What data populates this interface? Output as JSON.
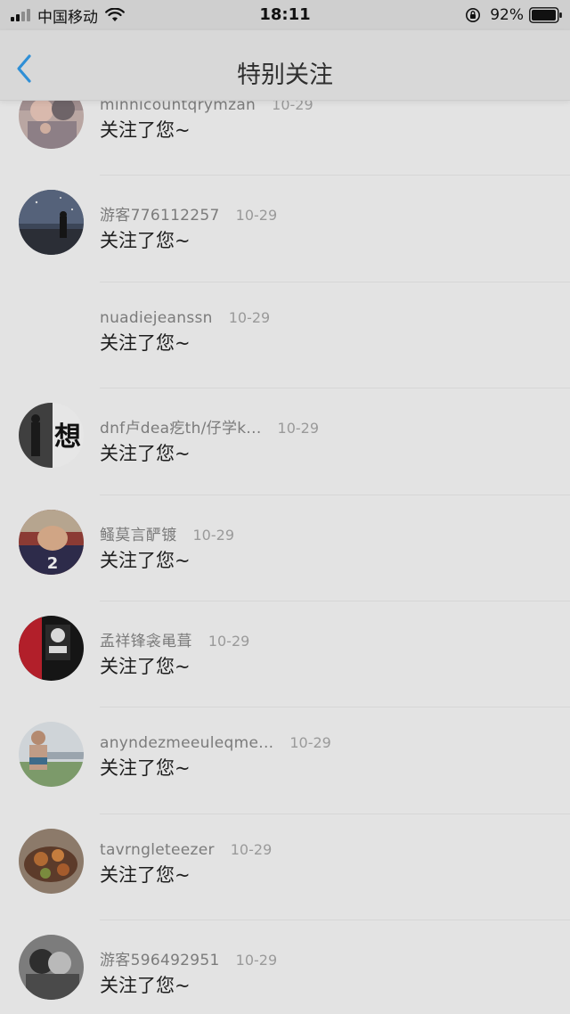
{
  "status_bar": {
    "carrier": "中国移动",
    "time": "18:11",
    "battery_percent": "92%"
  },
  "nav": {
    "title": "特别关注",
    "back_icon": "chevron-left-icon"
  },
  "colors": {
    "accent": "#2f8fd6",
    "overlay_bg": "#e3e3e3"
  },
  "notifications": [
    {
      "username": "minnicountqrymzan",
      "date": "10-29",
      "message": "关注了您~",
      "avatar": "couple-photo"
    },
    {
      "username": "游客776112257",
      "date": "10-29",
      "message": "关注了您~",
      "avatar": "night-sky"
    },
    {
      "username": "nuadiejeanssn",
      "date": "10-29",
      "message": "关注了您~",
      "avatar": "none"
    },
    {
      "username": "dnf卢dea疙th/仔学k...",
      "date": "10-29",
      "message": "关注了您~",
      "avatar": "xiang-text"
    },
    {
      "username": "鳋莫言酽镀",
      "date": "10-29",
      "message": "关注了您~",
      "avatar": "fist"
    },
    {
      "username": "孟祥锋衾黾葺",
      "date": "10-29",
      "message": "关注了您~",
      "avatar": "dark-red"
    },
    {
      "username": "anyndezmeeuleqme...",
      "date": "10-29",
      "message": "关注了您~",
      "avatar": "athlete"
    },
    {
      "username": "tavrngleteezer",
      "date": "10-29",
      "message": "关注了您~",
      "avatar": "food"
    },
    {
      "username": "游客596492951",
      "date": "10-29",
      "message": "关注了您~",
      "avatar": "bw-couple"
    }
  ]
}
